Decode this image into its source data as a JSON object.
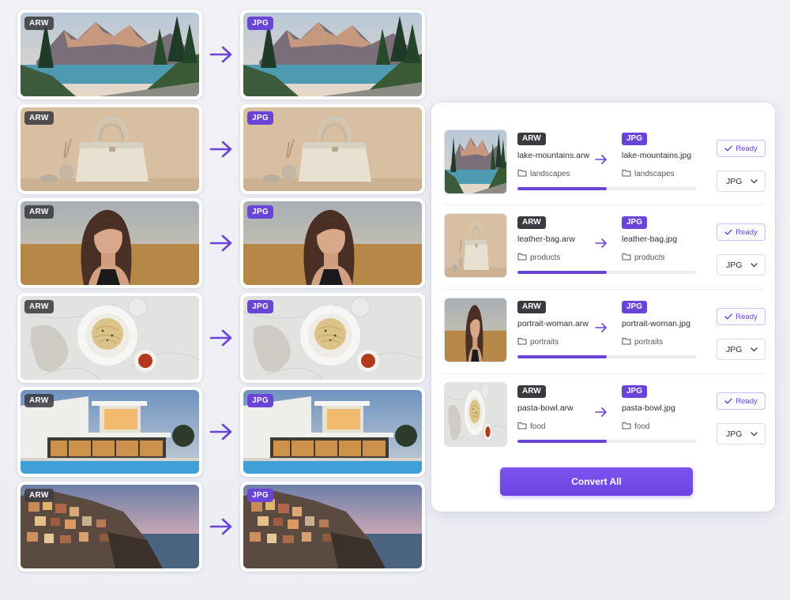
{
  "formats": {
    "source": "ARW",
    "target": "JPG"
  },
  "comparisons": [
    {
      "id": "mountains"
    },
    {
      "id": "bag"
    },
    {
      "id": "portrait"
    },
    {
      "id": "pasta"
    },
    {
      "id": "house"
    },
    {
      "id": "coast"
    }
  ],
  "files": [
    {
      "src_name": "lake-mountains.arw",
      "dst_name": "lake-mountains.jpg",
      "folder": "landscapes",
      "status": "Ready",
      "format": "JPG",
      "progress": 0.5
    },
    {
      "src_name": "leather-bag.arw",
      "dst_name": "leather-bag.jpg",
      "folder": "products",
      "status": "Ready",
      "format": "JPG",
      "progress": 0.5
    },
    {
      "src_name": "portrait-woman.arw",
      "dst_name": "portrait-woman.jpg",
      "folder": "portraits",
      "status": "Ready",
      "format": "JPG",
      "progress": 0.5
    },
    {
      "src_name": "pasta-bowl.arw",
      "dst_name": "pasta-bowl.jpg",
      "folder": "food",
      "status": "Ready",
      "format": "JPG",
      "progress": 0.5
    }
  ],
  "actions": {
    "convert_all": "Convert All"
  },
  "colors": {
    "accent": "#6a43d8",
    "raw_badge": "#3a3a40",
    "progress_track": "#ececf1"
  }
}
